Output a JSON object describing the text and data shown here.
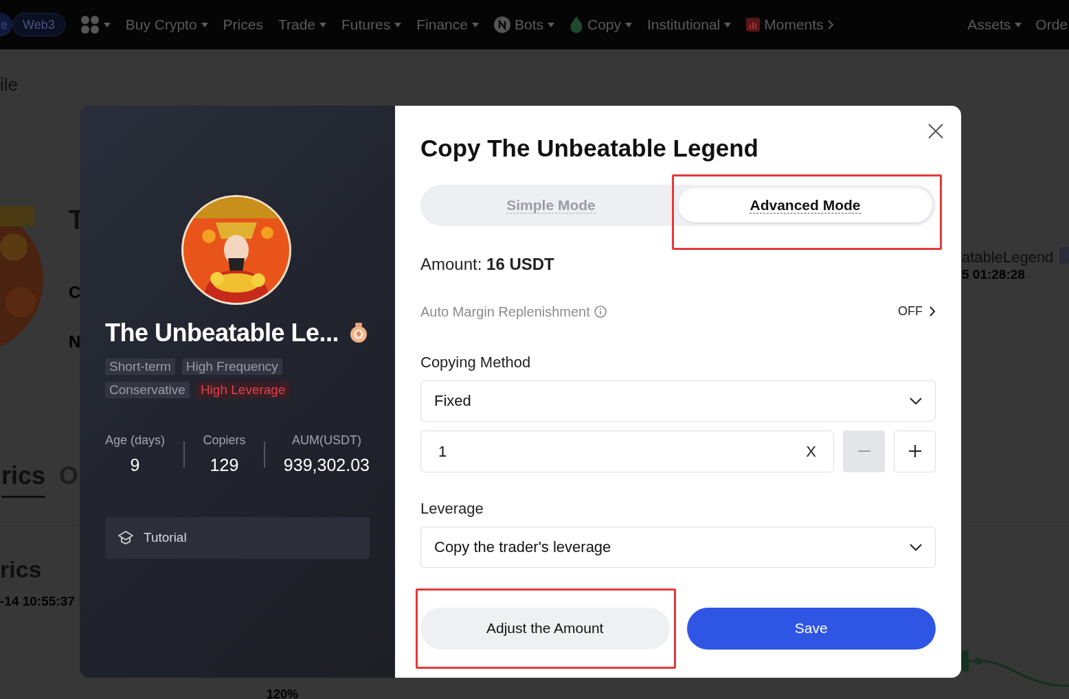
{
  "nav": {
    "items": [
      {
        "label": "e",
        "kind": "pill-cut"
      },
      {
        "label": "Web3",
        "kind": "pill"
      },
      {
        "kind": "grid",
        "caret": true
      },
      {
        "label": "Buy Crypto",
        "kind": "text",
        "caret": true
      },
      {
        "label": "Prices",
        "kind": "text",
        "caret": false
      },
      {
        "label": "Trade",
        "kind": "text",
        "caret": true
      },
      {
        "label": "Futures",
        "kind": "text",
        "caret": true
      },
      {
        "label": "Finance",
        "kind": "text",
        "caret": true
      },
      {
        "label": "Bots",
        "kind": "bots",
        "caret": true
      },
      {
        "label": "Copy",
        "kind": "leaf",
        "caret": true
      },
      {
        "label": "Institutional",
        "kind": "text",
        "caret": true
      },
      {
        "label": "Moments",
        "kind": "chart",
        "caret": false,
        "chevron": true
      }
    ],
    "right": [
      {
        "label": "Assets",
        "caret": true
      },
      {
        "label": "Orde",
        "caret": false
      }
    ]
  },
  "background": {
    "page_title": "ile",
    "name_initial": "T",
    "row_c": "C",
    "row_n": "N",
    "tab_active": "rics",
    "tab_next": "O",
    "section_title": "rics",
    "timestamp": "-14 10:55:37",
    "trader_name": "atableLegend",
    "trader_time": "5 01:28:28",
    "axis_label": "120%"
  },
  "profile": {
    "name": "The Unbeatable Le...",
    "tags": [
      {
        "label": "Short-term",
        "kind": "neutral"
      },
      {
        "label": "High Frequency",
        "kind": "neutral"
      },
      {
        "label": "Conservative",
        "kind": "neutral"
      },
      {
        "label": "High Leverage",
        "kind": "danger"
      }
    ],
    "stats": [
      {
        "label": "Age (days)",
        "value": "9"
      },
      {
        "label": "Copiers",
        "value": "129"
      },
      {
        "label": "AUM(USDT)",
        "value": "939,302.03"
      }
    ],
    "tutorial": "Tutorial"
  },
  "dialog": {
    "title": "Copy The Unbeatable Legend",
    "modes": [
      {
        "label": "Simple Mode",
        "selected": false,
        "highlighted": false
      },
      {
        "label": "Advanced Mode",
        "selected": true,
        "highlighted": true
      }
    ],
    "amount": "Amount: **16 USDT**",
    "auto_margin": {
      "label": "Auto Margin Replenishment",
      "value": "OFF"
    },
    "copying_method": {
      "label": "Copying Method",
      "value": "Fixed"
    },
    "multiplier": {
      "value": "1",
      "clear": "X",
      "minus_disabled": true
    },
    "leverage": {
      "label": "Leverage",
      "value": "Copy the trader's leverage"
    },
    "buttons": [
      {
        "label": "Adjust the Amount",
        "kind": "secondary",
        "highlighted": true
      },
      {
        "label": "Save",
        "kind": "primary",
        "highlighted": false
      }
    ]
  }
}
